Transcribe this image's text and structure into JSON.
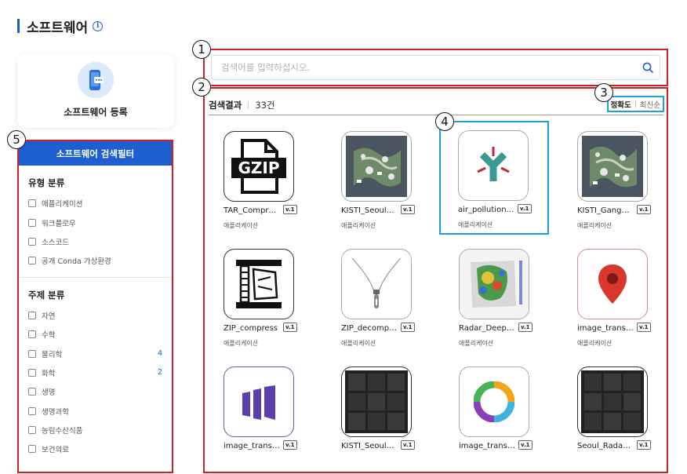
{
  "page": {
    "title": "소프트웨어",
    "info_glyph": "i"
  },
  "register": {
    "label": "소프트웨어 등록"
  },
  "markers": [
    "1",
    "2",
    "3",
    "4",
    "5"
  ],
  "filter": {
    "header": "소프트웨어 검색필터",
    "sections": [
      {
        "title": "유형 분류",
        "items": [
          {
            "label": "애플리케이션",
            "count": ""
          },
          {
            "label": "워크플로우",
            "count": ""
          },
          {
            "label": "소스코드",
            "count": ""
          },
          {
            "label": "공개 Conda 가상환경",
            "count": ""
          }
        ]
      },
      {
        "title": "주제 분류",
        "items": [
          {
            "label": "자연",
            "count": ""
          },
          {
            "label": "수학",
            "count": ""
          },
          {
            "label": "물리학",
            "count": "4"
          },
          {
            "label": "화학",
            "count": "2"
          },
          {
            "label": "생명",
            "count": ""
          },
          {
            "label": "생명과학",
            "count": ""
          },
          {
            "label": "농림수산식품",
            "count": ""
          },
          {
            "label": "보건의료",
            "count": ""
          }
        ]
      }
    ]
  },
  "search": {
    "placeholder": "검색어를 입력하십시오.",
    "value": ""
  },
  "results": {
    "label": "검색결과",
    "count": "33건",
    "sort": [
      {
        "label": "정확도",
        "active": true
      },
      {
        "label": "최신순",
        "active": false
      }
    ],
    "items": [
      {
        "name": "TAR_Compress",
        "version": "v.1",
        "category": "애플리케이션",
        "icon": "gzip-icon"
      },
      {
        "name": "KISTI_Seoul…",
        "version": "v.1",
        "category": "애플리케이션",
        "icon": "weather-map-icon"
      },
      {
        "name": "air_pollution…",
        "version": "v.1",
        "category": "애플리케이션",
        "icon": "y-shape-logo-icon"
      },
      {
        "name": "KISTI_Gang…",
        "version": "v.1",
        "category": "애플리케이션",
        "icon": "weather-map-icon"
      },
      {
        "name": "ZIP_compress",
        "version": "v.1",
        "category": "애플리케이션",
        "icon": "zip-compress-icon"
      },
      {
        "name": "ZIP_decomp…",
        "version": "v.1",
        "category": "애플리케이션",
        "icon": "zipper-icon"
      },
      {
        "name": "Radar_Deep…",
        "version": "v.1",
        "category": "애플리케이션",
        "icon": "radar-map-icon"
      },
      {
        "name": "image_trans…",
        "version": "v.1",
        "category": "애플리케이션",
        "icon": "map-pin-icon"
      },
      {
        "name": "image_trans…",
        "version": "v.1",
        "category": "",
        "icon": "purple-bars-icon"
      },
      {
        "name": "KISTI_Seoul…",
        "version": "v.1",
        "category": "",
        "icon": "dark-grid-icon"
      },
      {
        "name": "image_trans…",
        "version": "v.1",
        "category": "",
        "icon": "color-ring-icon"
      },
      {
        "name": "Seoul_Radar…",
        "version": "v.1",
        "category": "",
        "icon": "dark-grid-icon"
      }
    ]
  },
  "colors": {
    "accent": "#1d5fd0",
    "highlight_red": "#d02020",
    "highlight_blue": "#1ba3d9"
  }
}
